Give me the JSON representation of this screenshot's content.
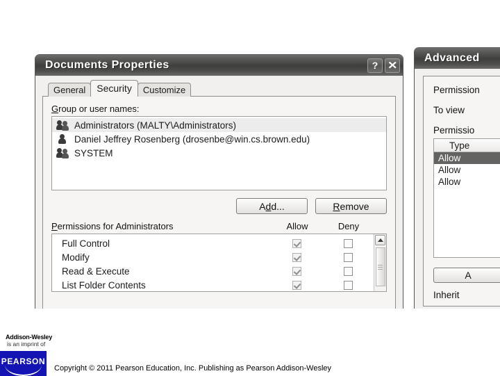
{
  "properties_dialog": {
    "title": "Documents Properties",
    "titlebar_buttons": [
      {
        "name": "help",
        "glyph": "?"
      },
      {
        "name": "close",
        "glyph": "✕"
      }
    ],
    "tabs": [
      {
        "label": "General",
        "active": false
      },
      {
        "label": "Security",
        "active": true
      },
      {
        "label": "Customize",
        "active": false
      }
    ],
    "group_label": "Group or user names:",
    "group_label_accel": "G",
    "group_label_rest": "roup or user names:",
    "users": [
      {
        "name": "Administrators (MALTY\\Administrators)",
        "icon": "group-users-icon",
        "selected": true
      },
      {
        "name": "Daniel Jeffrey Rosenberg (drosenbe@win.cs.brown.edu)",
        "icon": "single-user-icon",
        "selected": false
      },
      {
        "name": "SYSTEM",
        "icon": "group-users-icon",
        "selected": false
      }
    ],
    "buttons": [
      {
        "label": "Add...",
        "accel": "d",
        "name": "add-button"
      },
      {
        "label": "Remove",
        "accel": "R",
        "name": "remove-button"
      }
    ],
    "permissions_label": "Permissions for Administrators",
    "permissions_label_accel": "P",
    "permissions_label_rest": "ermissions for Administrators",
    "permission_columns": [
      "Allow",
      "Deny"
    ],
    "permissions": [
      {
        "name": "Full Control",
        "allow": true,
        "deny": false
      },
      {
        "name": "Modify",
        "allow": true,
        "deny": false
      },
      {
        "name": "Read & Execute",
        "allow": true,
        "deny": false
      },
      {
        "name": "List Folder Contents",
        "allow": true,
        "deny": false
      }
    ],
    "scrollbar": {
      "up_arrow": "scroll-up-arrow",
      "thumb": "scroll-thumb"
    }
  },
  "advanced_dialog": {
    "title": "Advanced",
    "lines": [
      "Permission",
      "To view",
      "Permissio"
    ],
    "column_header": "Type",
    "rows": [
      {
        "type": "Allow",
        "selected": true
      },
      {
        "type": "Allow",
        "selected": false
      },
      {
        "type": "Allow",
        "selected": false
      }
    ],
    "button_label": "A",
    "footer_text": "Inherit"
  },
  "footer": {
    "imprint_line1": "Addison-Wesley",
    "imprint_line2": "is an imprint of",
    "logo_word": "PEARSON",
    "copyright": "Copyright © 2011 Pearson Education, Inc. Publishing as Pearson Addison-Wesley"
  },
  "colors": {
    "titlebar_dark": "#3f3f3d",
    "dialog_face": "#f1f0ee",
    "panel_face": "#f6f5f3",
    "selection_gray": "#636361",
    "pearson_blue": "#1414b4"
  }
}
